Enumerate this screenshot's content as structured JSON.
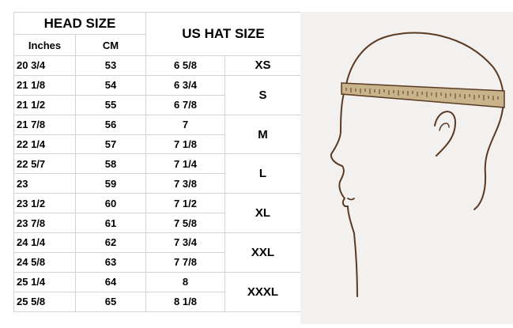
{
  "table": {
    "head_size_label": "HEAD SIZE",
    "inches_label": "Inches",
    "cm_label": "CM",
    "us_hat_size_label": "US HAT SIZE",
    "rows": [
      {
        "inches": "20 3/4",
        "cm": "53",
        "hat": "6 5/8"
      },
      {
        "inches": "21 1/8",
        "cm": "54",
        "hat": "6 3/4"
      },
      {
        "inches": "21 1/2",
        "cm": "55",
        "hat": "6 7/8"
      },
      {
        "inches": "21 7/8",
        "cm": "56",
        "hat": "7"
      },
      {
        "inches": "22 1/4",
        "cm": "57",
        "hat": "7 1/8"
      },
      {
        "inches": "22 5/7",
        "cm": "58",
        "hat": "7 1/4"
      },
      {
        "inches": "23",
        "cm": "59",
        "hat": "7 3/8"
      },
      {
        "inches": "23 1/2",
        "cm": "60",
        "hat": "7 1/2"
      },
      {
        "inches": "23 7/8",
        "cm": "61",
        "hat": "7 5/8"
      },
      {
        "inches": "24 1/4",
        "cm": "62",
        "hat": "7 3/4"
      },
      {
        "inches": "24 5/8",
        "cm": "63",
        "hat": "7 7/8"
      },
      {
        "inches": "25 1/4",
        "cm": "64",
        "hat": "8"
      },
      {
        "inches": "25 5/8",
        "cm": "65",
        "hat": "8 1/8"
      }
    ],
    "size_groups": [
      "XS",
      "S",
      "M",
      "L",
      "XL",
      "XXL",
      "XXXL"
    ]
  },
  "illustration": {
    "icon": "head-measurement-icon"
  },
  "colors": {
    "border": "#d3d3d3",
    "illustration_background": "#f2f1f0",
    "line": "#5a3a22"
  }
}
